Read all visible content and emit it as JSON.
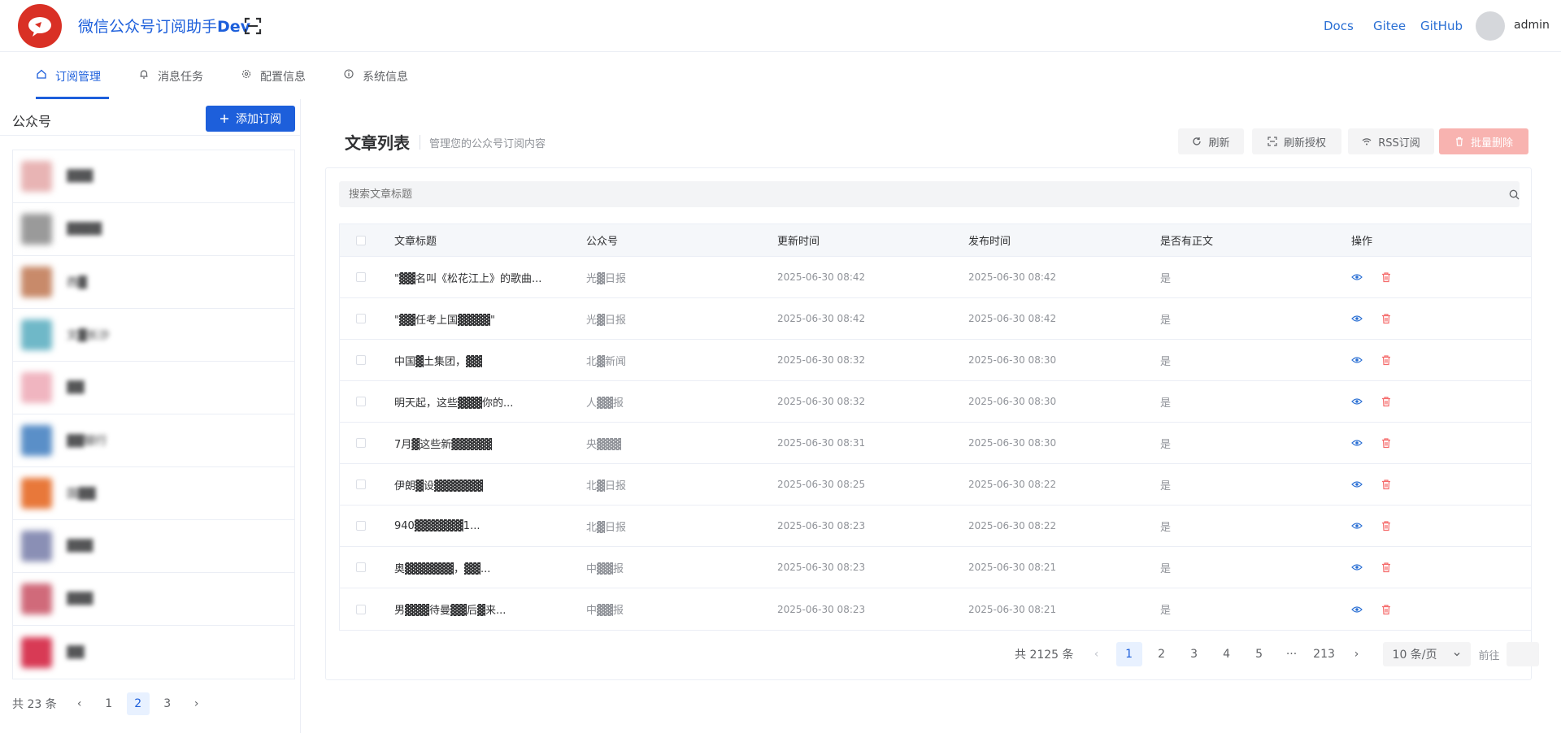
{
  "app": {
    "title_prefix": "微信公众号订阅助手",
    "title_suffix": "Dev"
  },
  "header": {
    "links": [
      "Docs",
      "Gitee",
      "GitHub"
    ],
    "username": "admin"
  },
  "tabs": [
    {
      "label": "订阅管理",
      "icon": "home-icon",
      "active": true
    },
    {
      "label": "消息任务",
      "icon": "bell-icon",
      "active": false
    },
    {
      "label": "配置信息",
      "icon": "gear-icon",
      "active": false
    },
    {
      "label": "系统信息",
      "icon": "info-icon",
      "active": false
    }
  ],
  "sidebar": {
    "title": "公众号",
    "add_button": "添加订阅",
    "accounts": [
      {
        "name": "▓▓▓",
        "color": "#e8b4b4"
      },
      {
        "name": "▓▓▓▓",
        "color": "#9a9a9a"
      },
      {
        "name": "西▓",
        "color": "#c88a6a"
      },
      {
        "name": "文▓长沙",
        "color": "#6fb8c8"
      },
      {
        "name": "▓▓",
        "color": "#f0b5c0"
      },
      {
        "name": "▓▓银行",
        "color": "#5a8fc8"
      },
      {
        "name": "国▓▓",
        "color": "#e8783a"
      },
      {
        "name": "▓▓▓",
        "color": "#8a8fb5"
      },
      {
        "name": "▓▓▓",
        "color": "#d06a7a"
      },
      {
        "name": "▓▓",
        "color": "#d83a55"
      }
    ],
    "pager": {
      "total": "共 23 条",
      "pages": [
        "1",
        "2",
        "3"
      ],
      "current": "2"
    }
  },
  "content": {
    "title": "文章列表",
    "subtitle": "管理您的公众号订阅内容",
    "buttons": {
      "refresh": "刷新",
      "refresh_auth": "刷新授权",
      "rss": "RSS订阅",
      "batch_delete": "批量删除"
    },
    "search_placeholder": "搜索文章标题",
    "columns": [
      "文章标题",
      "公众号",
      "更新时间",
      "发布时间",
      "是否有正文",
      "操作"
    ],
    "rows": [
      {
        "title": "\"▓▓名叫《松花江上》的歌曲...",
        "source": "光▓日报",
        "updated": "2025-06-30 08:42",
        "published": "2025-06-30 08:42",
        "has_body": "是"
      },
      {
        "title": "\"▓▓任考上国▓▓▓▓\"",
        "source": "光▓日报",
        "updated": "2025-06-30 08:42",
        "published": "2025-06-30 08:42",
        "has_body": "是"
      },
      {
        "title": "中国▓土集团，▓▓",
        "source": "北▓新闻",
        "updated": "2025-06-30 08:32",
        "published": "2025-06-30 08:30",
        "has_body": "是"
      },
      {
        "title": "明天起，这些▓▓▓你的...",
        "source": "人▓▓报",
        "updated": "2025-06-30 08:32",
        "published": "2025-06-30 08:30",
        "has_body": "是"
      },
      {
        "title": "7月▓这些新▓▓▓▓▓",
        "source": "央▓▓▓",
        "updated": "2025-06-30 08:31",
        "published": "2025-06-30 08:30",
        "has_body": "是"
      },
      {
        "title": "伊朗▓设▓▓▓▓▓▓",
        "source": "北▓日报",
        "updated": "2025-06-30 08:25",
        "published": "2025-06-30 08:22",
        "has_body": "是"
      },
      {
        "title": "940▓▓▓▓▓▓1...",
        "source": "北▓日报",
        "updated": "2025-06-30 08:23",
        "published": "2025-06-30 08:22",
        "has_body": "是"
      },
      {
        "title": "奥▓▓▓▓▓▓，▓▓...",
        "source": "中▓▓报",
        "updated": "2025-06-30 08:23",
        "published": "2025-06-30 08:21",
        "has_body": "是"
      },
      {
        "title": "男▓▓▓待曼▓▓后▓来...",
        "source": "中▓▓报",
        "updated": "2025-06-30 08:23",
        "published": "2025-06-30 08:21",
        "has_body": "是"
      }
    ],
    "pager": {
      "total": "共 2125 条",
      "pages": [
        "1",
        "2",
        "3",
        "4",
        "5",
        "···",
        "213"
      ],
      "current": "1",
      "page_size": "10 条/页",
      "goto_label": "前往"
    }
  },
  "colors": {
    "accent": "#1d5fdb",
    "danger": "#f56c6c",
    "logo": "#d93025"
  }
}
